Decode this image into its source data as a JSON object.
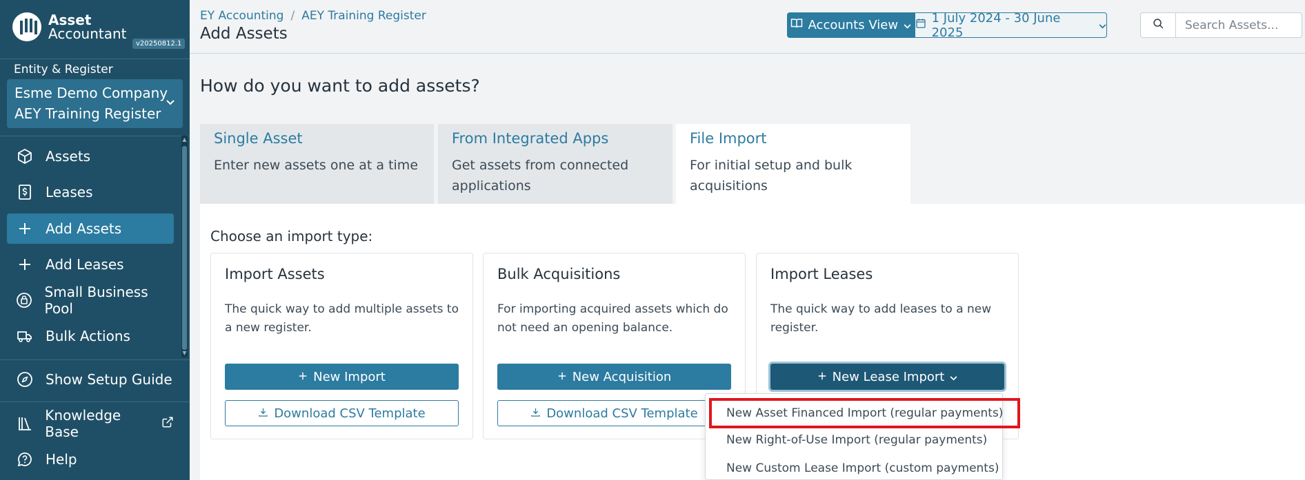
{
  "app": {
    "logo_line1": "Asset",
    "logo_line2": "Accountant",
    "version": "v20250812.1"
  },
  "sidebar": {
    "entity_label": "Entity & Register",
    "entity_name": "Esme Demo Company",
    "register_name": "AEY Training Register",
    "items": [
      {
        "label": "Assets",
        "icon": "cube-icon"
      },
      {
        "label": "Leases",
        "icon": "lease-document-icon"
      },
      {
        "label": "Add Assets",
        "icon": "plus-icon",
        "active": true
      },
      {
        "label": "Add Leases",
        "icon": "plus-icon"
      },
      {
        "label": "Small Business Pool",
        "icon": "pool-icon"
      },
      {
        "label": "Bulk Actions",
        "icon": "truck-icon"
      }
    ],
    "setup_guide": "Show Setup Guide",
    "knowledge_base": "Knowledge Base",
    "help": "Help"
  },
  "header": {
    "breadcrumb_root": "EY Accounting",
    "breadcrumb_separator": "/",
    "breadcrumb_register": "AEY Training Register",
    "title": "Add Assets",
    "view_label": "Accounts View",
    "date_range": "1 July 2024 - 30 June 2025",
    "search_placeholder": "Search Assets..."
  },
  "main": {
    "question": "How do you want to add assets?",
    "tabs": [
      {
        "title": "Single Asset",
        "desc": "Enter new assets one at a time"
      },
      {
        "title": "From Integrated Apps",
        "desc": "Get assets from connected applications"
      },
      {
        "title": "File Import",
        "desc": "For initial setup and bulk acquisitions",
        "active": true
      }
    ],
    "choose_label": "Choose an import type:",
    "cards": [
      {
        "title": "Import Assets",
        "desc": "The quick way to add multiple assets to a new register.",
        "primary": "New Import",
        "secondary": "Download CSV Template"
      },
      {
        "title": "Bulk Acquisitions",
        "desc": "For importing acquired assets which do not need an opening balance.",
        "primary": "New Acquisition",
        "secondary": "Download CSV Template"
      },
      {
        "title": "Import Leases",
        "desc": "The quick way to add leases to a new register.",
        "primary": "New Lease Import"
      }
    ],
    "dropdown": [
      "New Asset Financed Import (regular payments)",
      "New Right-of-Use Import (regular payments)",
      "New Custom Lease Import (custom payments)"
    ]
  },
  "colors": {
    "sidebar_bg": "#1f4f66",
    "accent": "#2c7ba0",
    "highlight_outline": "#e0161e"
  }
}
